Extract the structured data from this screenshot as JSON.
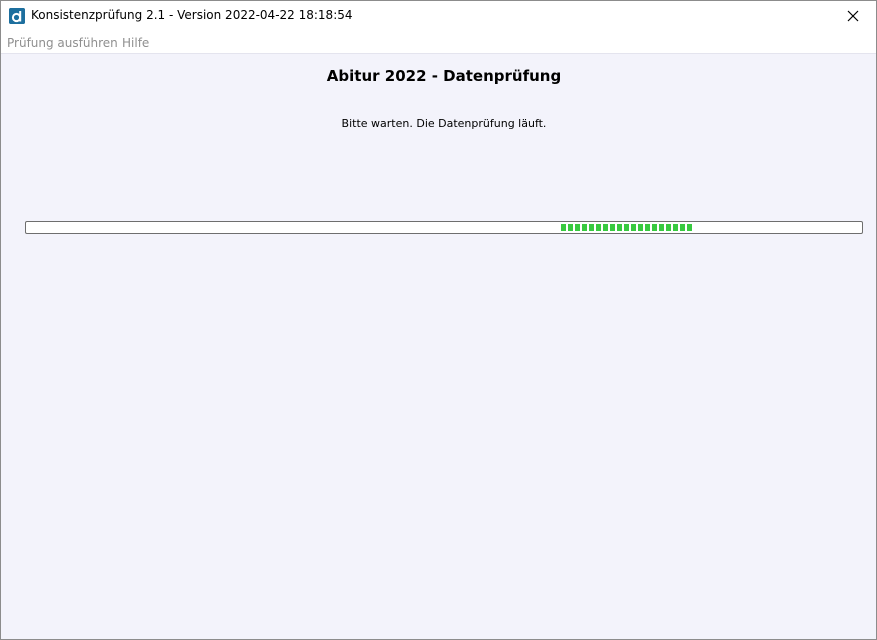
{
  "window": {
    "title": "Konsistenzprüfung 2.1 - Version 2022-04-22 18:18:54",
    "icon": "app-logo-icon",
    "close_icon": "close-icon"
  },
  "menu": {
    "items": [
      {
        "label": "Prüfung ausführen"
      },
      {
        "label": "Hilfe"
      }
    ]
  },
  "main": {
    "title": "Abitur 2022 - Datenprüfung",
    "status": "Bitte warten. Die Datenprüfung läuft."
  },
  "progress": {
    "mode": "indeterminate",
    "marquee_start": 0.64,
    "marquee_length": 0.16,
    "color": "#38c940"
  }
}
